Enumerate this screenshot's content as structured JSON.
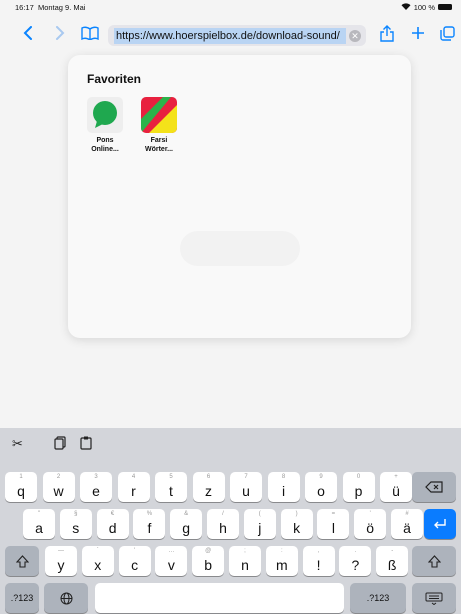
{
  "status": {
    "time": "16:17",
    "date": "Montag 9. Mai",
    "battery": "100 %"
  },
  "toolbar": {
    "back_icon": "chevron-left-icon",
    "forward_icon": "chevron-right-icon",
    "bookmarks_icon": "book-icon",
    "url": "https://www.hoerspielbox.de/download-sound/",
    "share_icon": "share-icon",
    "new_tab_icon": "plus-icon",
    "tabs_icon": "tabs-icon"
  },
  "favorites": {
    "title": "Favoriten",
    "items": [
      {
        "label_line1": "Pons",
        "label_line2": "Online...",
        "color": "#1fa84f"
      },
      {
        "label_line1": "Farsi",
        "label_line2": "Wörter...",
        "color": "#e8213f"
      }
    ]
  },
  "keyboard": {
    "row1": [
      {
        "k": "q",
        "h": "1"
      },
      {
        "k": "w",
        "h": "2"
      },
      {
        "k": "e",
        "h": "3"
      },
      {
        "k": "r",
        "h": "4"
      },
      {
        "k": "t",
        "h": "5"
      },
      {
        "k": "z",
        "h": "6"
      },
      {
        "k": "u",
        "h": "7"
      },
      {
        "k": "i",
        "h": "8"
      },
      {
        "k": "o",
        "h": "9"
      },
      {
        "k": "p",
        "h": "0"
      },
      {
        "k": "ü",
        "h": "+"
      }
    ],
    "row2": [
      {
        "k": "a",
        "h": "\""
      },
      {
        "k": "s",
        "h": "§"
      },
      {
        "k": "d",
        "h": "€"
      },
      {
        "k": "f",
        "h": "%"
      },
      {
        "k": "g",
        "h": "&"
      },
      {
        "k": "h",
        "h": "/"
      },
      {
        "k": "j",
        "h": "("
      },
      {
        "k": "k",
        "h": ")"
      },
      {
        "k": "l",
        "h": "="
      },
      {
        "k": "ö",
        "h": "'"
      },
      {
        "k": "ä",
        "h": "#"
      }
    ],
    "row3": [
      {
        "k": "y",
        "h": "—"
      },
      {
        "k": "x",
        "h": "`"
      },
      {
        "k": "c",
        "h": "'"
      },
      {
        "k": "v",
        "h": "…"
      },
      {
        "k": "b",
        "h": "@"
      },
      {
        "k": "n",
        "h": ";"
      },
      {
        "k": "m",
        "h": ":"
      },
      {
        "k": "!",
        "h": ","
      },
      {
        "k": "?",
        "h": "."
      },
      {
        "k": "ß",
        "h": "-"
      }
    ],
    "num_left": ".?123",
    "num_right": ".?123",
    "delete_icon": "delete-icon",
    "return_icon": "return-icon",
    "shift_icon": "shift-icon",
    "globe_icon": "globe-icon",
    "hide_icon": "keyboard-hide-icon",
    "tools": {
      "cut": "✂",
      "copy": "⎘",
      "paste": "📋"
    }
  }
}
